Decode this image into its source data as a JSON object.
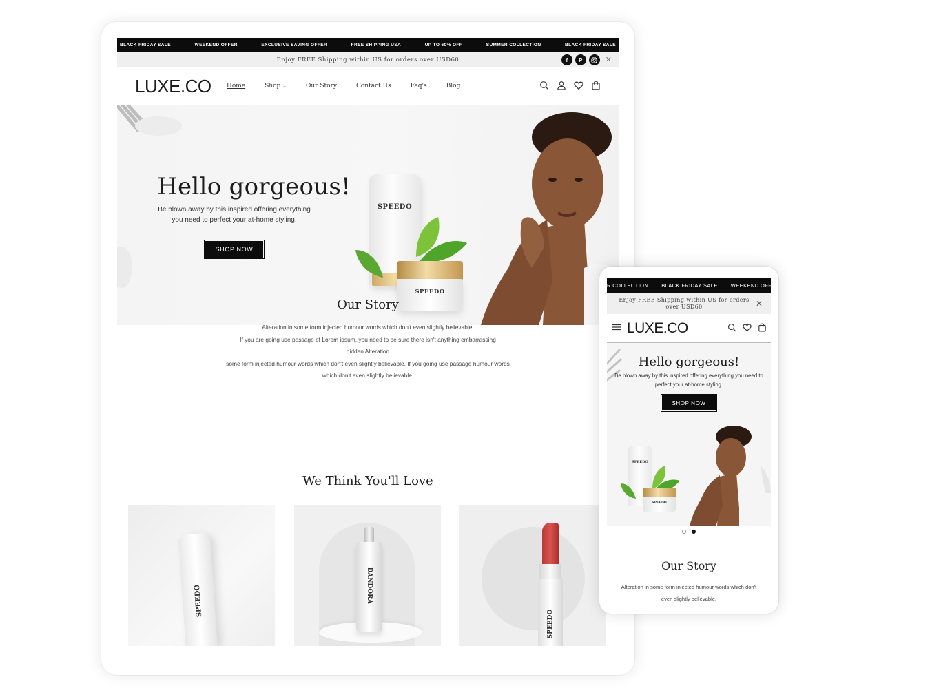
{
  "ticker": [
    "BLACK FRIDAY SALE",
    "WEEKEND OFFER",
    "EXCLUSIVE SAVING OFFER",
    "FREE SHIPPING USA",
    "UP TO 60% OFF",
    "SUMMER COLLECTION",
    "BLACK FRIDAY SALE"
  ],
  "announcement": "Enjoy FREE Shipping within US for orders over USD60",
  "brand": "LUXE.CO",
  "nav": {
    "links": [
      "Home",
      "Shop",
      "Our Story",
      "Contact Us",
      "Faq's",
      "Blog"
    ],
    "active": "Home"
  },
  "hero": {
    "title": "Hello gorgeous!",
    "text": "Be blown away by this inspired offering everything you need to perfect your at-home styling.",
    "button": "SHOP NOW",
    "product_brand": "SPEEDO"
  },
  "story": {
    "title": "Our Story",
    "lines": [
      "Alteration in some form injected humour words which don't even slightly believable.",
      "If you are going use passage of Lorem ipsum, you need to be sure there isn't anything embarrassing",
      "hidden Alteration",
      "some form injected humour words which don't even slightly believable. If you going use passage humour words",
      "which don't even slightly believable."
    ]
  },
  "love": {
    "title": "We Think You'll Love",
    "products": [
      {
        "brand": "SPEEDO"
      },
      {
        "brand": "DANDORA"
      },
      {
        "brand": "SPEEDO"
      }
    ]
  },
  "mobile": {
    "ticker": [
      "R COLLECTION",
      "BLACK FRIDAY SALE",
      "WEEKEND OFFER"
    ],
    "announcement": "Enjoy FREE Shipping within US for orders over USD60",
    "story_text": "Alteration in some form injected humour words which don't even slightly believable."
  }
}
